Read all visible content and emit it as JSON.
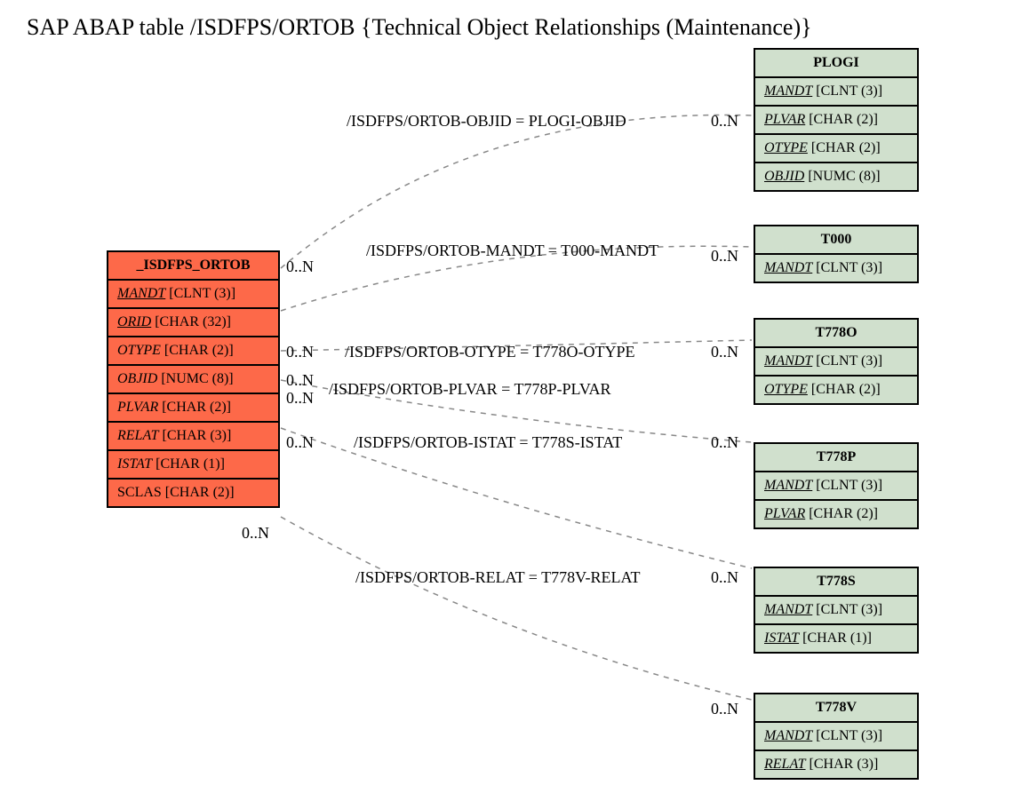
{
  "title": "SAP ABAP table /ISDFPS/ORTOB {Technical Object Relationships (Maintenance)}",
  "main_entity": {
    "name": "_ISDFPS_ORTOB",
    "fields": [
      {
        "name": "MANDT",
        "type": "[CLNT (3)]",
        "underline": true
      },
      {
        "name": "ORID",
        "type": "[CHAR (32)]",
        "underline": true
      },
      {
        "name": "OTYPE",
        "type": "[CHAR (2)]",
        "underline": false
      },
      {
        "name": "OBJID",
        "type": "[NUMC (8)]",
        "underline": false
      },
      {
        "name": "PLVAR",
        "type": "[CHAR (2)]",
        "underline": false
      },
      {
        "name": "RELAT",
        "type": "[CHAR (3)]",
        "underline": false
      },
      {
        "name": "ISTAT",
        "type": "[CHAR (1)]",
        "underline": false
      },
      {
        "name": "SCLAS",
        "type": "[CHAR (2)]",
        "underline": false,
        "italic": false
      }
    ]
  },
  "ref_entities": [
    {
      "name": "PLOGI",
      "fields": [
        {
          "name": "MANDT",
          "type": "[CLNT (3)]",
          "underline": true
        },
        {
          "name": "PLVAR",
          "type": "[CHAR (2)]",
          "underline": true
        },
        {
          "name": "OTYPE",
          "type": "[CHAR (2)]",
          "underline": true
        },
        {
          "name": "OBJID",
          "type": "[NUMC (8)]",
          "underline": true
        }
      ]
    },
    {
      "name": "T000",
      "fields": [
        {
          "name": "MANDT",
          "type": "[CLNT (3)]",
          "underline": true
        }
      ]
    },
    {
      "name": "T778O",
      "fields": [
        {
          "name": "MANDT",
          "type": "[CLNT (3)]",
          "underline": true
        },
        {
          "name": "OTYPE",
          "type": "[CHAR (2)]",
          "underline": true
        }
      ]
    },
    {
      "name": "T778P",
      "fields": [
        {
          "name": "MANDT",
          "type": "[CLNT (3)]",
          "underline": true
        },
        {
          "name": "PLVAR",
          "type": "[CHAR (2)]",
          "underline": true
        }
      ]
    },
    {
      "name": "T778S",
      "fields": [
        {
          "name": "MANDT",
          "type": "[CLNT (3)]",
          "underline": true
        },
        {
          "name": "ISTAT",
          "type": "[CHAR (1)]",
          "underline": true
        }
      ]
    },
    {
      "name": "T778V",
      "fields": [
        {
          "name": "MANDT",
          "type": "[CLNT (3)]",
          "underline": true
        },
        {
          "name": "RELAT",
          "type": "[CHAR (3)]",
          "underline": true
        }
      ]
    }
  ],
  "relations": [
    {
      "text": "/ISDFPS/ORTOB-OBJID = PLOGI-OBJID",
      "left_card": "0..N",
      "right_card": "0..N"
    },
    {
      "text": "/ISDFPS/ORTOB-MANDT = T000-MANDT",
      "left_card": "0..N",
      "right_card": "0..N"
    },
    {
      "text": "/ISDFPS/ORTOB-OTYPE = T778O-OTYPE",
      "left_card": "0..N",
      "right_card": "0..N"
    },
    {
      "text": "/ISDFPS/ORTOB-PLVAR = T778P-PLVAR",
      "left_card": "0..N",
      "right_card": "0..N"
    },
    {
      "text": "/ISDFPS/ORTOB-ISTAT = T778S-ISTAT",
      "left_card": "0..N",
      "right_card": "0..N"
    },
    {
      "text": "/ISDFPS/ORTOB-RELAT = T778V-RELAT",
      "left_card": "0..N",
      "right_card": "0..N"
    }
  ]
}
